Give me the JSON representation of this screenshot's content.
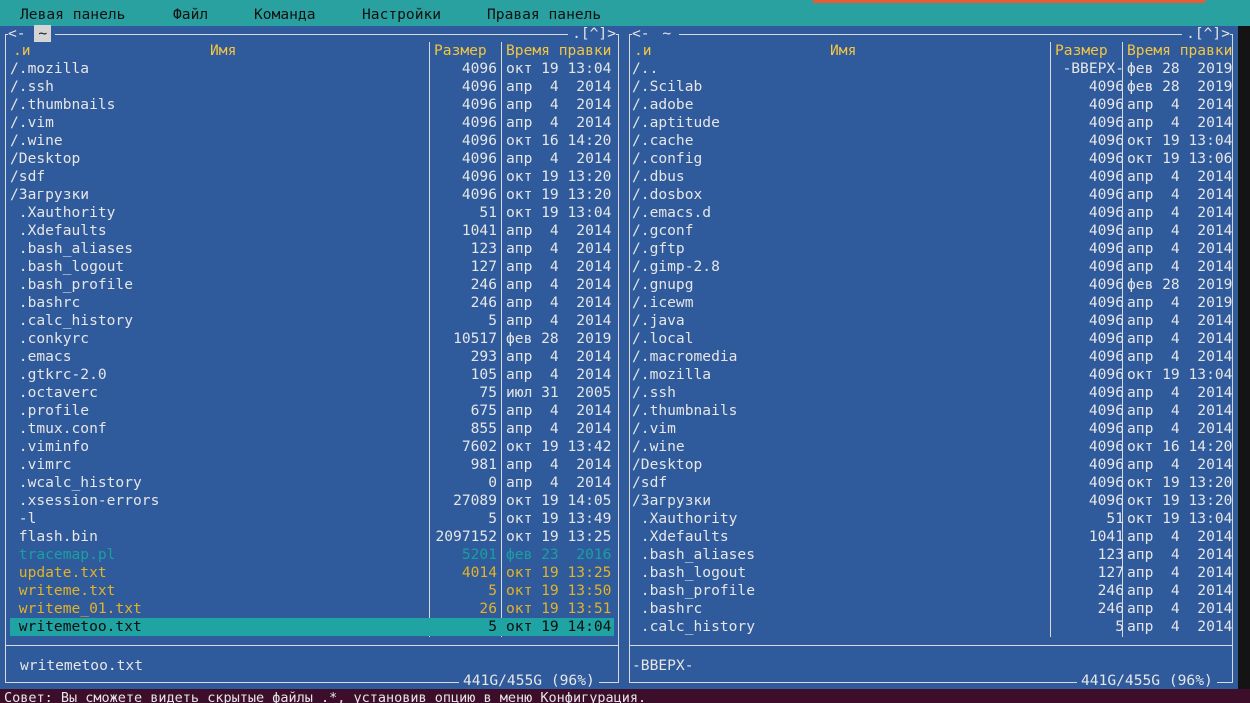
{
  "menu": {
    "items": [
      "Левая панель",
      "Файл",
      "Команда",
      "Настройки",
      "Правая панель"
    ]
  },
  "colors": {
    "panel_bg": "#2f5a9c",
    "menubar_bg": "#2aa1a1",
    "selection_bg": "#1fa3a3",
    "header_text": "#f4c542",
    "hint_bg": "#3c0e2a"
  },
  "left_panel": {
    "topbar_left": "<-",
    "path": "~",
    "topbar_right": ".[^]>",
    "headers": {
      "n": ".и",
      "name": "Имя",
      "size": "Размер",
      "time": "Время правки"
    },
    "rows": [
      {
        "name": "/.mozilla",
        "size": "4096",
        "date": "окт 19 13:04",
        "style": ""
      },
      {
        "name": "/.ssh",
        "size": "4096",
        "date": "апр  4  2014",
        "style": ""
      },
      {
        "name": "/.thumbnails",
        "size": "4096",
        "date": "апр  4  2014",
        "style": ""
      },
      {
        "name": "/.vim",
        "size": "4096",
        "date": "апр  4  2014",
        "style": ""
      },
      {
        "name": "/.wine",
        "size": "4096",
        "date": "окт 16 14:20",
        "style": ""
      },
      {
        "name": "/Desktop",
        "size": "4096",
        "date": "апр  4  2014",
        "style": ""
      },
      {
        "name": "/sdf",
        "size": "4096",
        "date": "окт 19 13:20",
        "style": ""
      },
      {
        "name": "/Загрузки",
        "size": "4096",
        "date": "окт 19 13:20",
        "style": ""
      },
      {
        "name": " .Xauthority",
        "size": "51",
        "date": "окт 19 13:04",
        "style": ""
      },
      {
        "name": " .Xdefaults",
        "size": "1041",
        "date": "апр  4  2014",
        "style": ""
      },
      {
        "name": " .bash_aliases",
        "size": "123",
        "date": "апр  4  2014",
        "style": ""
      },
      {
        "name": " .bash_logout",
        "size": "127",
        "date": "апр  4  2014",
        "style": ""
      },
      {
        "name": " .bash_profile",
        "size": "246",
        "date": "апр  4  2014",
        "style": ""
      },
      {
        "name": " .bashrc",
        "size": "246",
        "date": "апр  4  2014",
        "style": ""
      },
      {
        "name": " .calc_history",
        "size": "5",
        "date": "апр  4  2014",
        "style": ""
      },
      {
        "name": " .conkyrc",
        "size": "10517",
        "date": "фев 28  2019",
        "style": ""
      },
      {
        "name": " .emacs",
        "size": "293",
        "date": "апр  4  2014",
        "style": ""
      },
      {
        "name": " .gtkrc-2.0",
        "size": "105",
        "date": "апр  4  2014",
        "style": ""
      },
      {
        "name": " .octaverc",
        "size": "75",
        "date": "июл 31  2005",
        "style": ""
      },
      {
        "name": " .profile",
        "size": "675",
        "date": "апр  4  2014",
        "style": ""
      },
      {
        "name": " .tmux.conf",
        "size": "855",
        "date": "апр  4  2014",
        "style": ""
      },
      {
        "name": " .viminfo",
        "size": "7602",
        "date": "окт 19 13:42",
        "style": ""
      },
      {
        "name": " .vimrc",
        "size": "981",
        "date": "апр  4  2014",
        "style": ""
      },
      {
        "name": " .wcalc_history",
        "size": "0",
        "date": "апр  4  2014",
        "style": ""
      },
      {
        "name": " .xsession-errors",
        "size": "27089",
        "date": "окт 19 14:05",
        "style": ""
      },
      {
        "name": " -l",
        "size": "5",
        "date": "окт 19 13:49",
        "style": ""
      },
      {
        "name": " flash.bin",
        "size": "2097152",
        "date": "окт 19 13:25",
        "style": ""
      },
      {
        "name": " tracemap.pl",
        "size": "5201",
        "date": "фев 23  2016",
        "style": "tea"
      },
      {
        "name": " update.txt",
        "size": "4014",
        "date": "окт 19 13:25",
        "style": "yel"
      },
      {
        "name": " writeme.txt",
        "size": "5",
        "date": "окт 19 13:50",
        "style": "yel"
      },
      {
        "name": " writeme_01.txt",
        "size": "26",
        "date": "окт 19 13:51",
        "style": "yel"
      },
      {
        "name": " writemetoo.txt",
        "size": "5",
        "date": "окт 19 14:04",
        "style": "sel"
      }
    ],
    "mini_status": "writemetoo.txt",
    "free_space": "441G/455G (96%)"
  },
  "right_panel": {
    "topbar_left": "<-",
    "path": "~",
    "topbar_right": ".[^]>",
    "headers": {
      "n": ".и",
      "name": "Имя",
      "size": "Размер",
      "time": "Время правки"
    },
    "rows": [
      {
        "name": "/..",
        "size": "-ВВЕРХ-",
        "date": "фев 28  2019",
        "style": ""
      },
      {
        "name": "/.Scilab",
        "size": "4096",
        "date": "фев 28  2019",
        "style": ""
      },
      {
        "name": "/.adobe",
        "size": "4096",
        "date": "апр  4  2014",
        "style": ""
      },
      {
        "name": "/.aptitude",
        "size": "4096",
        "date": "апр  4  2014",
        "style": ""
      },
      {
        "name": "/.cache",
        "size": "4096",
        "date": "окт 19 13:04",
        "style": ""
      },
      {
        "name": "/.config",
        "size": "4096",
        "date": "окт 19 13:06",
        "style": ""
      },
      {
        "name": "/.dbus",
        "size": "4096",
        "date": "апр  4  2014",
        "style": ""
      },
      {
        "name": "/.dosbox",
        "size": "4096",
        "date": "апр  4  2014",
        "style": ""
      },
      {
        "name": "/.emacs.d",
        "size": "4096",
        "date": "апр  4  2014",
        "style": ""
      },
      {
        "name": "/.gconf",
        "size": "4096",
        "date": "апр  4  2014",
        "style": ""
      },
      {
        "name": "/.gftp",
        "size": "4096",
        "date": "апр  4  2014",
        "style": ""
      },
      {
        "name": "/.gimp-2.8",
        "size": "4096",
        "date": "апр  4  2014",
        "style": ""
      },
      {
        "name": "/.gnupg",
        "size": "4096",
        "date": "фев 28  2019",
        "style": ""
      },
      {
        "name": "/.icewm",
        "size": "4096",
        "date": "апр  4  2019",
        "style": ""
      },
      {
        "name": "/.java",
        "size": "4096",
        "date": "апр  4  2014",
        "style": ""
      },
      {
        "name": "/.local",
        "size": "4096",
        "date": "апр  4  2014",
        "style": ""
      },
      {
        "name": "/.macromedia",
        "size": "4096",
        "date": "апр  4  2014",
        "style": ""
      },
      {
        "name": "/.mozilla",
        "size": "4096",
        "date": "окт 19 13:04",
        "style": ""
      },
      {
        "name": "/.ssh",
        "size": "4096",
        "date": "апр  4  2014",
        "style": ""
      },
      {
        "name": "/.thumbnails",
        "size": "4096",
        "date": "апр  4  2014",
        "style": ""
      },
      {
        "name": "/.vim",
        "size": "4096",
        "date": "апр  4  2014",
        "style": ""
      },
      {
        "name": "/.wine",
        "size": "4096",
        "date": "окт 16 14:20",
        "style": ""
      },
      {
        "name": "/Desktop",
        "size": "4096",
        "date": "апр  4  2014",
        "style": ""
      },
      {
        "name": "/sdf",
        "size": "4096",
        "date": "окт 19 13:20",
        "style": ""
      },
      {
        "name": "/Загрузки",
        "size": "4096",
        "date": "окт 19 13:20",
        "style": ""
      },
      {
        "name": " .Xauthority",
        "size": "51",
        "date": "окт 19 13:04",
        "style": ""
      },
      {
        "name": " .Xdefaults",
        "size": "1041",
        "date": "апр  4  2014",
        "style": ""
      },
      {
        "name": " .bash_aliases",
        "size": "123",
        "date": "апр  4  2014",
        "style": ""
      },
      {
        "name": " .bash_logout",
        "size": "127",
        "date": "апр  4  2014",
        "style": ""
      },
      {
        "name": " .bash_profile",
        "size": "246",
        "date": "апр  4  2014",
        "style": ""
      },
      {
        "name": " .bashrc",
        "size": "246",
        "date": "апр  4  2014",
        "style": ""
      },
      {
        "name": " .calc_history",
        "size": "5",
        "date": "апр  4  2014",
        "style": ""
      }
    ],
    "mini_status": "-ВВЕРХ-",
    "free_space": "441G/455G (96%)"
  },
  "hint": "Совет: Вы сможете видеть скрытые файлы .*, установив опцию в меню Конфигурация."
}
